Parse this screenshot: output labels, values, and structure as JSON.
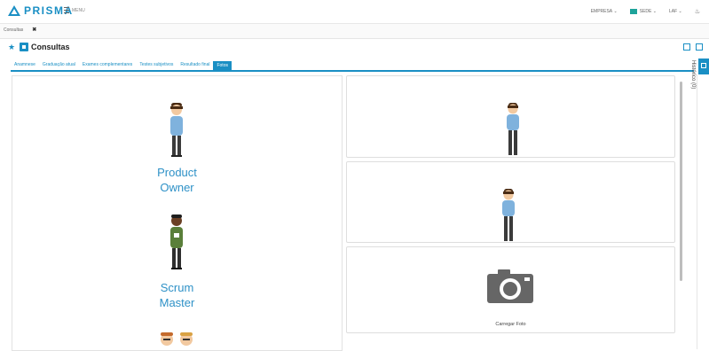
{
  "header": {
    "app_name": "PRISMA",
    "menu_label": "MENU",
    "company_label": "EMPRESA",
    "site_label": "SEDE",
    "user_label": "LAF",
    "accent": "#1a8fc4"
  },
  "doc_tabs": [
    {
      "label": "Consultas"
    }
  ],
  "page": {
    "title": "Consultas"
  },
  "subtabs": [
    {
      "label": "Anamnese"
    },
    {
      "label": "Graduação atual"
    },
    {
      "label": "Exames complementares"
    },
    {
      "label": "Testes subjetivos"
    },
    {
      "label": "Resultado final"
    },
    {
      "label": "Fotos",
      "active": true
    }
  ],
  "roles": [
    {
      "line1": "Product",
      "line2": "Owner"
    },
    {
      "line1": "Scrum",
      "line2": "Master"
    }
  ],
  "photo_cards": {
    "upload_caption": "Carregar Foto"
  },
  "history": {
    "label": "Histórico (0)"
  }
}
